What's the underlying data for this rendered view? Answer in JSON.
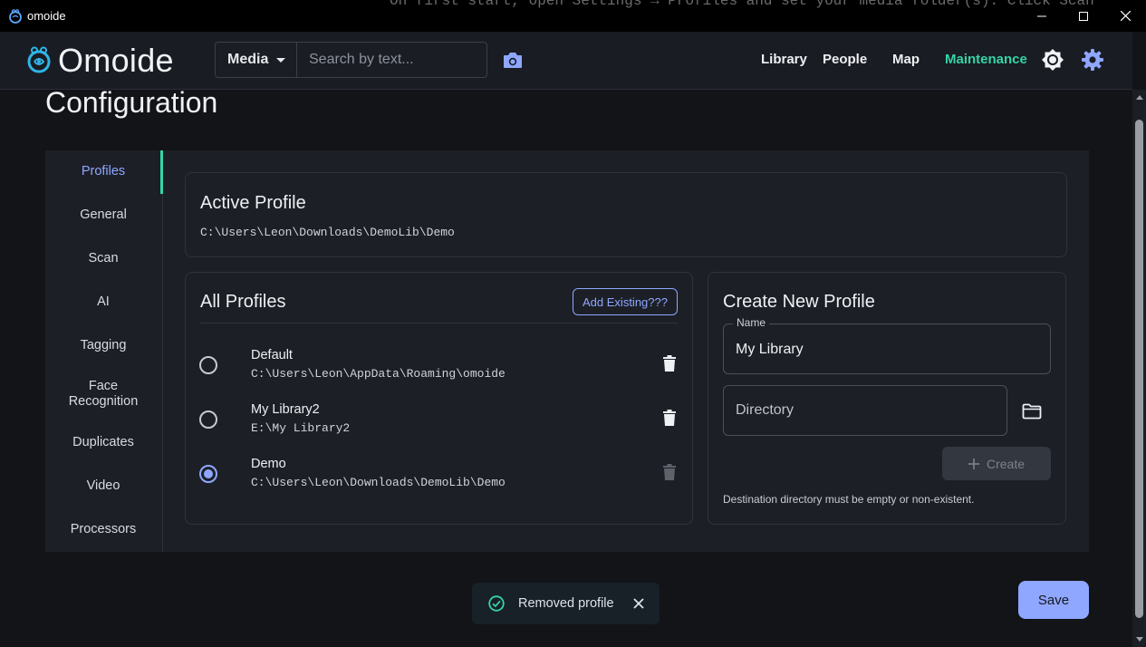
{
  "window": {
    "title": "omoide",
    "background_text": "On first start, open Settings → Profiles and set your media folder(s). Click Scan"
  },
  "header": {
    "logo_text": "Omoide",
    "media_select": "Media",
    "search_placeholder": "Search by text...",
    "nav": [
      "Library",
      "People",
      "Map",
      "Maintenance"
    ],
    "active_nav": "Maintenance"
  },
  "page": {
    "title": "Configuration",
    "tabs": [
      "Profiles",
      "General",
      "Scan",
      "AI",
      "Tagging",
      "Face Recognition",
      "Duplicates",
      "Video",
      "Processors"
    ],
    "active_tab": "Profiles"
  },
  "active_profile": {
    "title": "Active Profile",
    "path": "C:\\Users\\Leon\\Downloads\\DemoLib\\Demo"
  },
  "all_profiles": {
    "title": "All Profiles",
    "add_existing_label": "Add Existing???",
    "profiles": [
      {
        "name": "Default",
        "path": "C:\\Users\\Leon\\AppData\\Roaming\\omoide",
        "selected": false,
        "deletable": true
      },
      {
        "name": "My Library2",
        "path": "E:\\My Library2",
        "selected": false,
        "deletable": true
      },
      {
        "name": "Demo",
        "path": "C:\\Users\\Leon\\Downloads\\DemoLib\\Demo",
        "selected": true,
        "deletable": false
      }
    ]
  },
  "create_profile": {
    "title": "Create New Profile",
    "name_label": "Name",
    "name_value": "My Library",
    "directory_placeholder": "Directory",
    "create_label": "Create",
    "hint": "Destination directory must be empty or non-existent."
  },
  "toast": {
    "message": "Removed profile"
  },
  "save_label": "Save",
  "colors": {
    "accent": "#8fa7ff",
    "active_nav": "#35d4a6",
    "background": "#121418",
    "panel": "#1c1f26"
  }
}
